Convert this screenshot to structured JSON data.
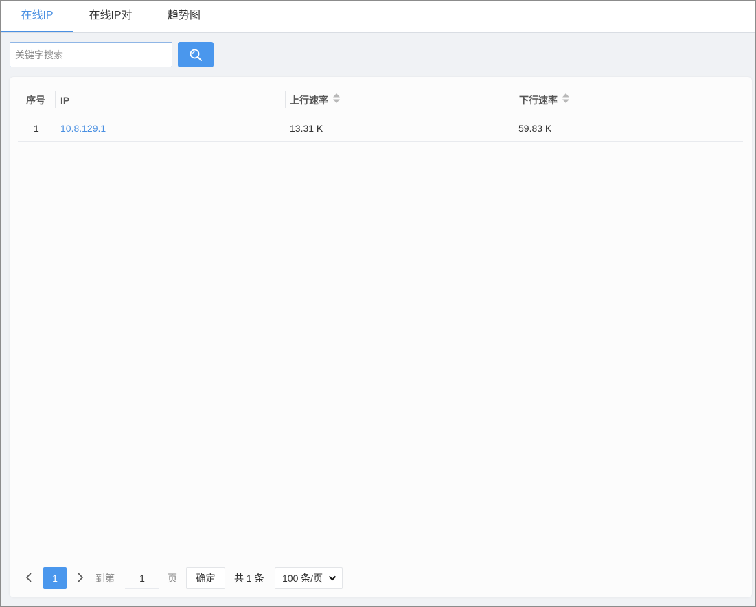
{
  "tabs": [
    {
      "label": "在线IP",
      "active": true
    },
    {
      "label": "在线IP对",
      "active": false
    },
    {
      "label": "趋势图",
      "active": false
    }
  ],
  "search": {
    "placeholder": "关键字搜索",
    "button_icon": "search-icon"
  },
  "table": {
    "columns": [
      {
        "label": "序号",
        "sortable": false
      },
      {
        "label": "IP",
        "sortable": false
      },
      {
        "label": "上行速率",
        "sortable": true
      },
      {
        "label": "下行速率",
        "sortable": true
      }
    ],
    "rows": [
      {
        "index": "1",
        "ip": "10.8.129.1",
        "up": "13.31 K",
        "down": "59.83 K"
      }
    ]
  },
  "pagination": {
    "current_page": "1",
    "goto_prefix": "到第",
    "goto_value": "1",
    "goto_suffix": "页",
    "confirm_label": "确定",
    "total_text": "共 1 条",
    "page_size": "100 条/页"
  },
  "colors": {
    "accent": "#4a90e2",
    "button": "#4a97ed",
    "background": "#f0f2f5"
  }
}
